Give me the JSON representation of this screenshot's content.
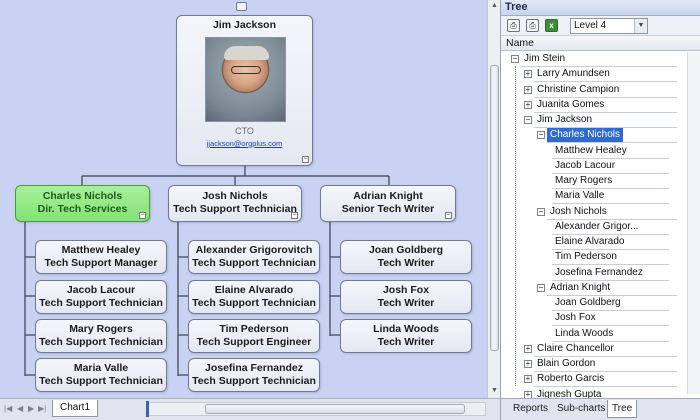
{
  "chart": {
    "root": {
      "name": "Jim Jackson",
      "title": "CTO",
      "email": "jjackson@orgplus.com"
    },
    "managers": [
      {
        "name": "Charles Nichols",
        "title": "Dir. Tech Services"
      },
      {
        "name": "Josh Nichols",
        "title": "Tech Support Technician"
      },
      {
        "name": "Adrian Knight",
        "title": "Senior Tech Writer"
      }
    ],
    "col1": [
      {
        "name": "Matthew  Healey",
        "title": "Tech Support Manager"
      },
      {
        "name": "Jacob  Lacour",
        "title": "Tech Support Technician"
      },
      {
        "name": "Mary  Rogers",
        "title": "Tech Support Technician"
      },
      {
        "name": "Maria  Valle",
        "title": "Tech Support Technician"
      }
    ],
    "col2": [
      {
        "name": "Alexander Grigorovitch",
        "title": "Tech Support Technician"
      },
      {
        "name": "Elaine  Alvarado",
        "title": "Tech Support Technician"
      },
      {
        "name": "Tim  Pederson",
        "title": "Tech Support Engineer"
      },
      {
        "name": "Josefina  Fernandez",
        "title": "Tech Support Technician"
      }
    ],
    "col3": [
      {
        "name": "Joan  Goldberg",
        "title": "Tech Writer"
      },
      {
        "name": "Josh  Fox",
        "title": "Tech Writer"
      },
      {
        "name": "Linda  Woods",
        "title": "Tech Writer"
      }
    ]
  },
  "sheet_tab": "Chart1",
  "panel": {
    "title": "Tree",
    "level": "Level 4",
    "column_header": "Name",
    "tabs": [
      "Reports",
      "Sub-charts",
      "Tree"
    ],
    "tree": [
      {
        "label": "Jim Stein",
        "box": "−"
      },
      {
        "label": "Larry  Amundsen",
        "box": "+"
      },
      {
        "label": "Christine  Campion",
        "box": "+"
      },
      {
        "label": "Juanita  Gomes",
        "box": "+"
      },
      {
        "label": "Jim  Jackson",
        "box": "−"
      },
      {
        "label": "Charles  Nichols",
        "box": "−"
      },
      {
        "label": "Matthew  Healey",
        "box": ""
      },
      {
        "label": "Jacob  Lacour",
        "box": ""
      },
      {
        "label": "Mary  Rogers",
        "box": ""
      },
      {
        "label": "Maria  Valle",
        "box": ""
      },
      {
        "label": "Josh  Nichols",
        "box": "−"
      },
      {
        "label": "Alexander  Grigor...",
        "box": ""
      },
      {
        "label": "Elaine  Alvarado",
        "box": ""
      },
      {
        "label": "Tim  Pederson",
        "box": ""
      },
      {
        "label": "Josefina  Fernandez",
        "box": ""
      },
      {
        "label": "Adrian  Knight",
        "box": "−"
      },
      {
        "label": "Joan  Goldberg",
        "box": ""
      },
      {
        "label": "Josh  Fox",
        "box": ""
      },
      {
        "label": "Linda  Woods",
        "box": ""
      },
      {
        "label": "Claire  Chancellor",
        "box": "+"
      },
      {
        "label": "Blain Gordon",
        "box": "+"
      },
      {
        "label": "Roberto  Garcis",
        "box": "+"
      },
      {
        "label": "Jignesh  Gupta",
        "box": "+"
      }
    ]
  }
}
